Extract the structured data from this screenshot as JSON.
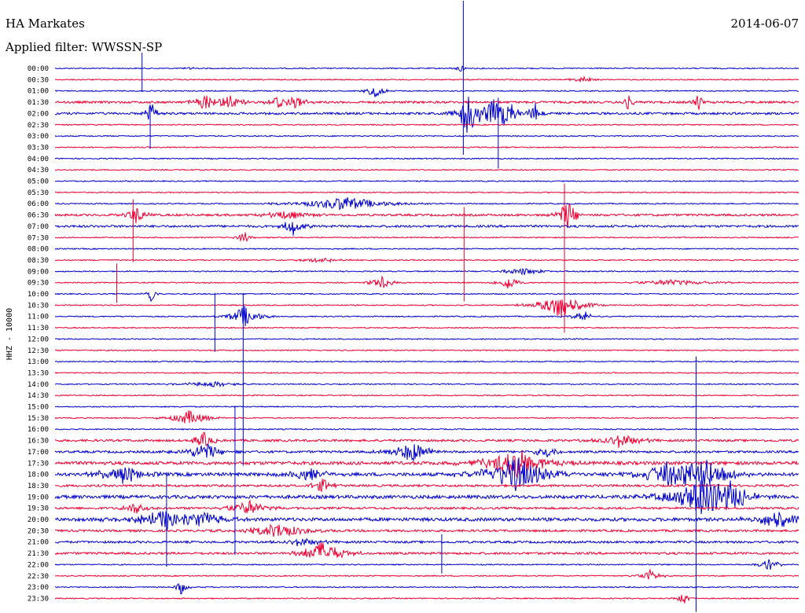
{
  "header": {
    "station": "HA Markates",
    "date": "2014-06-07",
    "filter_label": "Applied filter:",
    "filter_value": "WWSSN-SP"
  },
  "chart_data": {
    "type": "line",
    "title": "HA Markates",
    "ylabel": "HHZ - 10000",
    "colors": [
      "#0000cc",
      "#ee0033"
    ],
    "row_labels": [
      "00:00",
      "00:30",
      "01:00",
      "01:30",
      "02:00",
      "02:30",
      "03:00",
      "03:30",
      "04:00",
      "04:30",
      "05:00",
      "05:30",
      "06:00",
      "06:30",
      "07:00",
      "07:30",
      "08:00",
      "08:30",
      "09:00",
      "09:30",
      "10:00",
      "10:30",
      "11:00",
      "11:30",
      "12:00",
      "12:30",
      "13:00",
      "13:30",
      "14:00",
      "14:30",
      "15:00",
      "15:30",
      "16:00",
      "16:30",
      "17:00",
      "17:30",
      "18:00",
      "18:30",
      "19:00",
      "19:30",
      "20:00",
      "20:30",
      "21:00",
      "21:30",
      "22:00",
      "22:30",
      "23:00",
      "23:30"
    ],
    "noise_level": [
      1,
      1,
      1,
      2,
      2,
      1,
      1,
      1,
      1,
      1,
      1,
      1,
      1,
      2,
      2,
      1,
      1,
      1,
      1,
      1,
      1,
      1,
      1,
      1,
      1,
      1,
      1,
      1,
      1,
      1,
      1,
      1,
      1,
      2,
      2,
      3,
      3,
      2,
      3,
      2,
      3,
      2,
      2,
      2,
      1,
      1,
      1,
      1
    ],
    "events": [
      {
        "row": 0,
        "t": 0.18,
        "amp": 4,
        "dur": 0.004
      },
      {
        "row": 0,
        "t": 0.545,
        "amp": 6,
        "dur": 0.005
      },
      {
        "row": 1,
        "t": 0.71,
        "amp": 5,
        "dur": 0.01
      },
      {
        "row": 2,
        "t": 0.43,
        "amp": 8,
        "dur": 0.01
      },
      {
        "row": 3,
        "t": 0.2,
        "amp": 14,
        "dur": 0.01
      },
      {
        "row": 3,
        "t": 0.235,
        "amp": 10,
        "dur": 0.012
      },
      {
        "row": 3,
        "t": 0.3,
        "amp": 8,
        "dur": 0.01
      },
      {
        "row": 3,
        "t": 0.325,
        "amp": 8,
        "dur": 0.01
      },
      {
        "row": 3,
        "t": 0.77,
        "amp": 10,
        "dur": 0.005
      },
      {
        "row": 3,
        "t": 0.865,
        "amp": 12,
        "dur": 0.005
      },
      {
        "row": 4,
        "t": 0.13,
        "amp": 16,
        "dur": 0.006
      },
      {
        "row": 4,
        "t": 0.555,
        "amp": 30,
        "dur": 0.01
      },
      {
        "row": 4,
        "t": 0.59,
        "amp": 18,
        "dur": 0.02
      },
      {
        "row": 4,
        "t": 0.605,
        "amp": 24,
        "dur": 0.008
      },
      {
        "row": 4,
        "t": 0.645,
        "amp": 14,
        "dur": 0.006
      },
      {
        "row": 12,
        "t": 0.39,
        "amp": 10,
        "dur": 0.04
      },
      {
        "row": 13,
        "t": 0.11,
        "amp": 12,
        "dur": 0.01
      },
      {
        "row": 13,
        "t": 0.31,
        "amp": 6,
        "dur": 0.02
      },
      {
        "row": 13,
        "t": 0.69,
        "amp": 20,
        "dur": 0.01
      },
      {
        "row": 14,
        "t": 0.32,
        "amp": 12,
        "dur": 0.01
      },
      {
        "row": 15,
        "t": 0.255,
        "amp": 10,
        "dur": 0.006
      },
      {
        "row": 17,
        "t": 0.36,
        "amp": 4,
        "dur": 0.02
      },
      {
        "row": 18,
        "t": 0.63,
        "amp": 5,
        "dur": 0.02
      },
      {
        "row": 19,
        "t": 0.44,
        "amp": 10,
        "dur": 0.01
      },
      {
        "row": 19,
        "t": 0.61,
        "amp": 10,
        "dur": 0.01
      },
      {
        "row": 19,
        "t": 0.83,
        "amp": 4,
        "dur": 0.04
      },
      {
        "row": 20,
        "t": 0.13,
        "amp": 12,
        "dur": 0.005
      },
      {
        "row": 21,
        "t": 0.68,
        "amp": 18,
        "dur": 0.02
      },
      {
        "row": 22,
        "t": 0.255,
        "amp": 14,
        "dur": 0.015
      },
      {
        "row": 22,
        "t": 0.71,
        "amp": 8,
        "dur": 0.01
      },
      {
        "row": 28,
        "t": 0.21,
        "amp": 4,
        "dur": 0.03
      },
      {
        "row": 31,
        "t": 0.18,
        "amp": 10,
        "dur": 0.02
      },
      {
        "row": 33,
        "t": 0.2,
        "amp": 10,
        "dur": 0.01
      },
      {
        "row": 33,
        "t": 0.76,
        "amp": 10,
        "dur": 0.02
      },
      {
        "row": 34,
        "t": 0.2,
        "amp": 12,
        "dur": 0.02
      },
      {
        "row": 34,
        "t": 0.48,
        "amp": 14,
        "dur": 0.02
      },
      {
        "row": 34,
        "t": 0.66,
        "amp": 10,
        "dur": 0.01
      },
      {
        "row": 35,
        "t": 0.62,
        "amp": 20,
        "dur": 0.03
      },
      {
        "row": 36,
        "t": 0.09,
        "amp": 14,
        "dur": 0.02
      },
      {
        "row": 36,
        "t": 0.34,
        "amp": 10,
        "dur": 0.02
      },
      {
        "row": 36,
        "t": 0.62,
        "amp": 24,
        "dur": 0.03
      },
      {
        "row": 36,
        "t": 0.82,
        "amp": 14,
        "dur": 0.03
      },
      {
        "row": 36,
        "t": 0.87,
        "amp": 22,
        "dur": 0.03
      },
      {
        "row": 37,
        "t": 0.36,
        "amp": 10,
        "dur": 0.01
      },
      {
        "row": 38,
        "t": 0.87,
        "amp": 28,
        "dur": 0.03
      },
      {
        "row": 38,
        "t": 0.91,
        "amp": 16,
        "dur": 0.02
      },
      {
        "row": 39,
        "t": 0.11,
        "amp": 10,
        "dur": 0.01
      },
      {
        "row": 39,
        "t": 0.26,
        "amp": 10,
        "dur": 0.02
      },
      {
        "row": 40,
        "t": 0.15,
        "amp": 14,
        "dur": 0.03
      },
      {
        "row": 40,
        "t": 0.2,
        "amp": 10,
        "dur": 0.02
      },
      {
        "row": 40,
        "t": 0.97,
        "amp": 14,
        "dur": 0.02
      },
      {
        "row": 41,
        "t": 0.3,
        "amp": 10,
        "dur": 0.03
      },
      {
        "row": 42,
        "t": 0.33,
        "amp": 6,
        "dur": 0.02
      },
      {
        "row": 43,
        "t": 0.36,
        "amp": 16,
        "dur": 0.02
      },
      {
        "row": 44,
        "t": 0.96,
        "amp": 8,
        "dur": 0.01
      },
      {
        "row": 45,
        "t": 0.8,
        "amp": 8,
        "dur": 0.01
      },
      {
        "row": 46,
        "t": 0.17,
        "amp": 10,
        "dur": 0.006
      },
      {
        "row": 47,
        "t": 0.845,
        "amp": 10,
        "dur": 0.006
      }
    ],
    "spikes": [
      {
        "row": 0,
        "t": 0.549,
        "up": 86,
        "down": 110,
        "color": "#0000cc"
      },
      {
        "row": 0,
        "t": 0.117,
        "up": 20,
        "down": 30,
        "color": "#0000cc"
      },
      {
        "row": 4,
        "t": 0.128,
        "up": 10,
        "down": 45,
        "color": "#0000cc"
      },
      {
        "row": 4,
        "t": 0.596,
        "up": 20,
        "down": 70,
        "color": "#0000cc"
      },
      {
        "row": 13,
        "t": 0.685,
        "up": 40,
        "down": 150,
        "color": "#ee0033"
      },
      {
        "row": 13,
        "t": 0.105,
        "up": 20,
        "down": 60,
        "color": "#ee0033"
      },
      {
        "row": 13,
        "t": 0.55,
        "up": 10,
        "down": 110,
        "color": "#ee0033"
      },
      {
        "row": 18,
        "t": 0.083,
        "up": 10,
        "down": 40,
        "color": "#ee0033"
      },
      {
        "row": 22,
        "t": 0.215,
        "up": 30,
        "down": 45,
        "color": "#0000cc"
      },
      {
        "row": 22,
        "t": 0.253,
        "up": 30,
        "down": 190,
        "color": "#0000cc"
      },
      {
        "row": 32,
        "t": 0.242,
        "up": 30,
        "down": 160,
        "color": "#0000cc"
      },
      {
        "row": 36,
        "t": 0.862,
        "up": 150,
        "down": 175,
        "color": "#0000cc"
      },
      {
        "row": 40,
        "t": 0.15,
        "up": 60,
        "down": 60,
        "color": "#0000cc"
      },
      {
        "row": 42,
        "t": 0.52,
        "up": 10,
        "down": 40,
        "color": "#0000cc"
      },
      {
        "row": 43,
        "t": 0.5,
        "up": 1,
        "down": 1,
        "color": "#ee0033"
      }
    ]
  }
}
